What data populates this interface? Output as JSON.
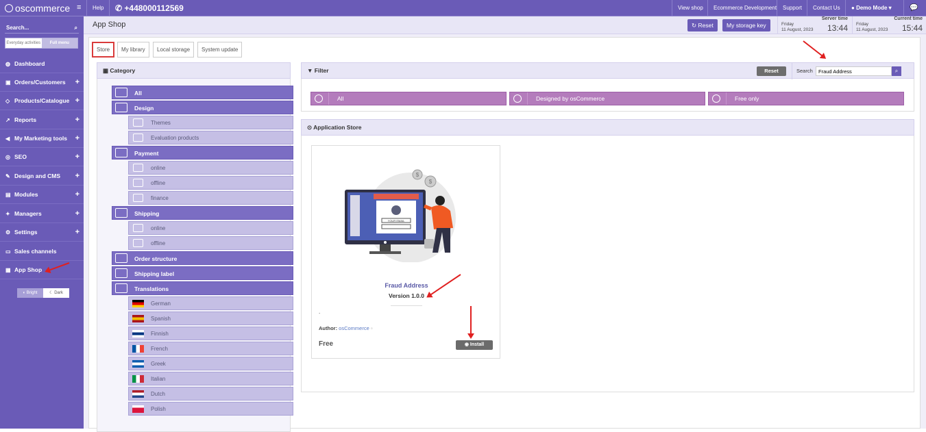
{
  "topbar": {
    "logo": "oscommerce",
    "help": "Help",
    "phone": "+448000112569",
    "links": [
      "View shop",
      "Ecommerce Development",
      "Support",
      "Contact Us"
    ],
    "user": "Demo Mode"
  },
  "sidebar": {
    "search_placeholder": "Search...",
    "mode_everyday": "Everyday activities",
    "mode_full": "Full menu",
    "items": [
      {
        "label": "Dashboard",
        "icon": "dashboard-icon",
        "plus": ""
      },
      {
        "label": "Orders/Customers",
        "icon": "box-icon",
        "plus": "+"
      },
      {
        "label": "Products/Catalogue",
        "icon": "tag-icon",
        "plus": "+"
      },
      {
        "label": "Reports",
        "icon": "chart-icon",
        "plus": "+"
      },
      {
        "label": "My Marketing tools",
        "icon": "megaphone-icon",
        "plus": "+"
      },
      {
        "label": "SEO",
        "icon": "globe-icon",
        "plus": "+"
      },
      {
        "label": "Design and CMS",
        "icon": "brush-icon",
        "plus": "+"
      },
      {
        "label": "Modules",
        "icon": "modules-icon",
        "plus": "+"
      },
      {
        "label": "Managers",
        "icon": "managers-icon",
        "plus": "+"
      },
      {
        "label": "Settings",
        "icon": "gear-icon",
        "plus": "+"
      },
      {
        "label": "Sales channels",
        "icon": "monitor-icon",
        "plus": ""
      },
      {
        "label": "App Shop",
        "icon": "shop-icon",
        "plus": ""
      }
    ],
    "theme_bright": "Bright",
    "theme_dark": "Dark"
  },
  "header": {
    "title": "App Shop",
    "reset": "Reset",
    "storage_key": "My storage key",
    "server_time_label": "Server time",
    "server_day": "Friday",
    "server_date": "11 August, 2023",
    "server_clock": "13:44",
    "current_time_label": "Current time",
    "current_day": "Friday",
    "current_date": "11 August, 2023",
    "current_clock": "15:44"
  },
  "tabs": [
    "Store",
    "My library",
    "Local storage",
    "System update"
  ],
  "category": {
    "heading": "Category",
    "rows": [
      {
        "label": "All",
        "level": 0
      },
      {
        "label": "Design",
        "level": 0
      },
      {
        "label": "Themes",
        "level": 1
      },
      {
        "label": "Evaluation products",
        "level": 1
      },
      {
        "label": "Payment",
        "level": 0
      },
      {
        "label": "online",
        "level": 1
      },
      {
        "label": "offline",
        "level": 1
      },
      {
        "label": "finance",
        "level": 1
      },
      {
        "label": "Shipping",
        "level": 0
      },
      {
        "label": "online",
        "level": 1
      },
      {
        "label": "offline",
        "level": 1
      },
      {
        "label": "Order structure",
        "level": 0
      },
      {
        "label": "Shipping label",
        "level": 0
      },
      {
        "label": "Translations",
        "level": 0
      },
      {
        "label": "German",
        "level": 1,
        "flag": [
          "#000000",
          "#dd0000",
          "#ffce00"
        ]
      },
      {
        "label": "Spanish",
        "level": 1,
        "flag": [
          "#aa151b",
          "#f1bf00",
          "#aa151b"
        ]
      },
      {
        "label": "Finnish",
        "level": 1,
        "flag": [
          "#ffffff",
          "#003580",
          "#ffffff"
        ]
      },
      {
        "label": "French",
        "level": 1,
        "flag": [
          "#0055a4",
          "#ffffff",
          "#ef4135"
        ],
        "vertical": true
      },
      {
        "label": "Greek",
        "level": 1,
        "flag": [
          "#0d5eaf",
          "#ffffff",
          "#0d5eaf"
        ]
      },
      {
        "label": "Italian",
        "level": 1,
        "flag": [
          "#009246",
          "#ffffff",
          "#ce2b37"
        ],
        "vertical": true
      },
      {
        "label": "Dutch",
        "level": 1,
        "flag": [
          "#ae1c28",
          "#ffffff",
          "#21468b"
        ]
      },
      {
        "label": "Polish",
        "level": 1,
        "flag": [
          "#ffffff",
          "#dc143c",
          "#dc143c"
        ]
      }
    ]
  },
  "filter": {
    "heading": "Filter",
    "reset": "Reset",
    "search_label": "Search",
    "search_value": "Fraud Address",
    "buttons": [
      "All",
      "Designed by osCommerce",
      "Free only"
    ]
  },
  "store": {
    "heading": "Application Store",
    "app": {
      "name": "Fraud Address",
      "version": "Version 1.0.0",
      "dot": ".",
      "author_label": "Author:",
      "author": "osCommerce",
      "price": "Free",
      "install": "Install",
      "illustration_text": "YOUR EMAIL"
    }
  },
  "colors": {
    "brand": "#6a5bb7",
    "accent_filter": "#b47cbc",
    "annotation": "#e02020"
  }
}
